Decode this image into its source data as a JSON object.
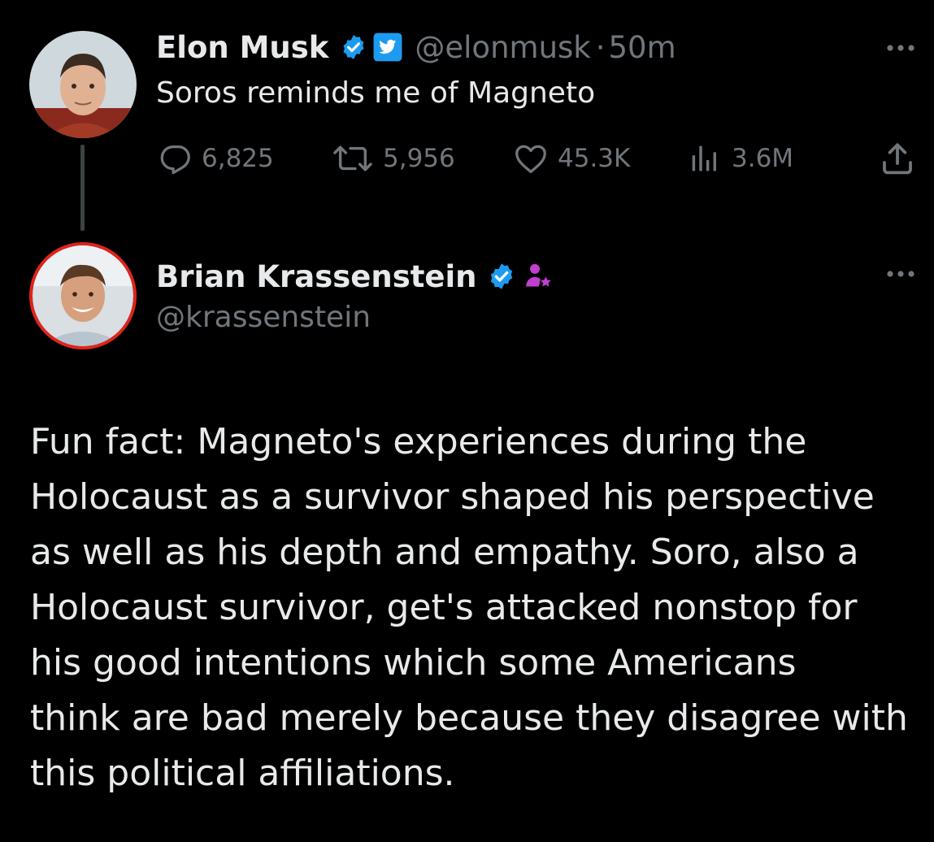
{
  "original_tweet": {
    "author_name": "Elon Musk",
    "handle": "@elonmusk",
    "separator": "·",
    "time": "50m",
    "text": "Soros reminds me of Magneto",
    "stats": {
      "replies": "6,825",
      "retweets": "5,956",
      "likes": "45.3K",
      "views": "3.6M"
    },
    "badges": [
      "verified-badge-icon",
      "twitter-bird-badge-icon"
    ]
  },
  "reply_tweet": {
    "author_name": "Brian Krassenstein",
    "handle": "@krassenstein",
    "badges": [
      "verified-badge-icon",
      "person-star-icon"
    ],
    "text_lines": [
      "Fun fact:  Magneto's experiences during the",
      "Holocaust as a survivor shaped his perspective",
      "as well as his depth and empathy.  Soro, also a",
      "Holocaust survivor, get's attacked nonstop for",
      "his good intentions which some Americans",
      "think are bad merely because they disagree with",
      "this political affiliations."
    ]
  },
  "colors": {
    "background": "#000000",
    "primary_text": "#e7e9ea",
    "secondary_text": "#71767b",
    "verified_blue": "#1d9bf0",
    "badge_purple": "#c03fd0",
    "avatar_ring_red": "#e0241b",
    "thread_line": "#3e4144"
  }
}
